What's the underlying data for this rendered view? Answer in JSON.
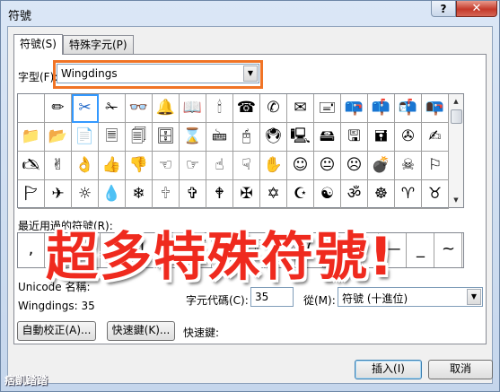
{
  "window": {
    "title": "符號",
    "help_glyph": "?",
    "close_glyph": "✕"
  },
  "tabs": [
    {
      "label": "符號(S)"
    },
    {
      "label": "特殊字元(P)"
    }
  ],
  "font": {
    "label": "字型(F):",
    "value": "Wingdings"
  },
  "symbol_grid": {
    "selected_index": 2,
    "rows": [
      [
        " ",
        "✏",
        "✂",
        "✁",
        "👓",
        "🔔",
        "📖",
        "🕯",
        "☎",
        "✆",
        "✉",
        "🖃",
        "📪",
        "📫",
        "📬",
        "📭"
      ],
      [
        "📁",
        "📂",
        "📄",
        "🗏",
        "🗐",
        "🗄",
        "⌛",
        "🖮",
        "🖰",
        "🖲",
        "🖳",
        "🖴",
        "🖫",
        "🖬",
        "✇",
        "✍"
      ],
      [
        "🖎",
        "✌",
        "👌",
        "👍",
        "👎",
        "☜",
        "☞",
        "☝",
        "☟",
        "✋",
        "☺",
        "😐",
        "☹",
        "💣",
        "☠",
        "⚐"
      ],
      [
        "🏱",
        "✈",
        "☼",
        "💧",
        "❄",
        "🕆",
        "✞",
        "🕈",
        "✠",
        "✡",
        "☪",
        "☯",
        "ॐ",
        "☸",
        "♈",
        "♉"
      ]
    ]
  },
  "recent": {
    "label": "最近用過的符號(R):",
    "symbols": [
      ",",
      "。",
      "、",
      "?",
      "!",
      ":",
      "「",
      "」",
      "『",
      "』",
      "(",
      ")",
      "'",
      "—",
      "_",
      "~"
    ]
  },
  "overlay_banner": "超多特殊符號!",
  "unicode_name_label": "Unicode 名稱:",
  "char_description": "Wingdings: 35",
  "char_code": {
    "label": "字元代碼(C):",
    "value": "35"
  },
  "from": {
    "label": "從(M):",
    "value": "符號 (十進位)"
  },
  "buttons": {
    "autocorrect": "自動校正(A)...",
    "shortcut_key": "快速鍵(K)...",
    "insert": "插入(I)",
    "cancel": "取消"
  },
  "shortcut_label": "快速鍵:",
  "watermark": "痞凱踏踏"
}
